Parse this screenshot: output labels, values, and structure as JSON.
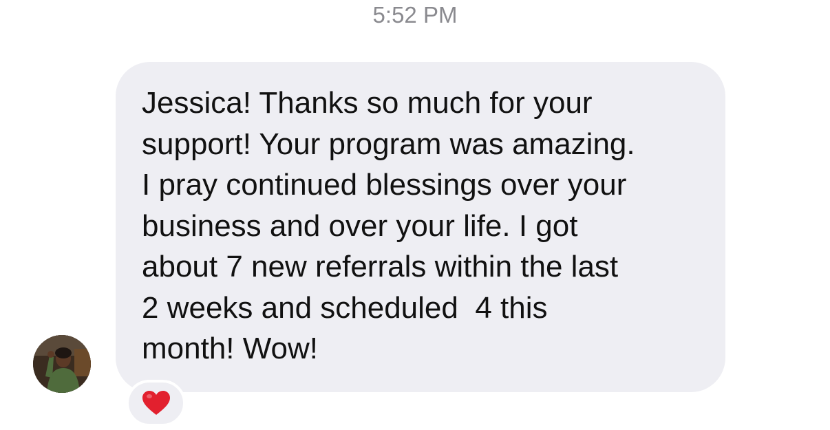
{
  "conversation": {
    "timestamp": "5:52 PM",
    "message": {
      "lines": [
        "Jessica! Thanks so much for your",
        "support! Your program was amazing.",
        "I pray continued blessings over your",
        "business and over your life. I got",
        "about 7 new referrals within the last",
        "2 weeks and scheduled  4 this",
        "month! Wow!"
      ],
      "reaction_icon": "red-heart-icon"
    },
    "sender_avatar": "profile-photo"
  },
  "colors": {
    "bubble": "#eeeef3",
    "timestamp": "#8a8a8f",
    "text": "#111111",
    "heart": "#e2202e"
  }
}
